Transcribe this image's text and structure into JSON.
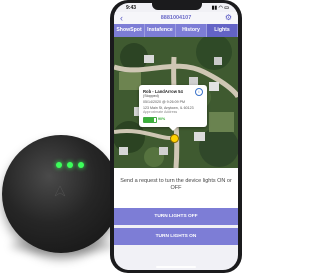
{
  "status_bar": {
    "time": "9:43",
    "signal": "▮▮ ◠ ▭"
  },
  "nav": {
    "back_glyph": "‹",
    "title": "8881004107",
    "settings_glyph": "⚙"
  },
  "tabs": [
    {
      "label": "ShowSpot"
    },
    {
      "label": "Instafence"
    },
    {
      "label": "History"
    },
    {
      "label": "Lights"
    }
  ],
  "popup": {
    "name": "Rob - LandArrow 54",
    "tag": "(Stopped)",
    "timestamp": "05/14/2020 @ 9:26:09 PM",
    "address": "123 Main St, Anytown, IL 60123",
    "approx": "Approximate Address",
    "info_glyph": "i",
    "battery_label": "90%",
    "battery_level": 0.8
  },
  "lights_panel": {
    "message": "Send a request to turn the device lights ON or OFF",
    "off_button": "TURN LIGHTS OFF",
    "on_button": "TURN LIGHTS ON"
  },
  "colors": {
    "accent": "#7d7dd6",
    "led": "#3cff5a"
  }
}
